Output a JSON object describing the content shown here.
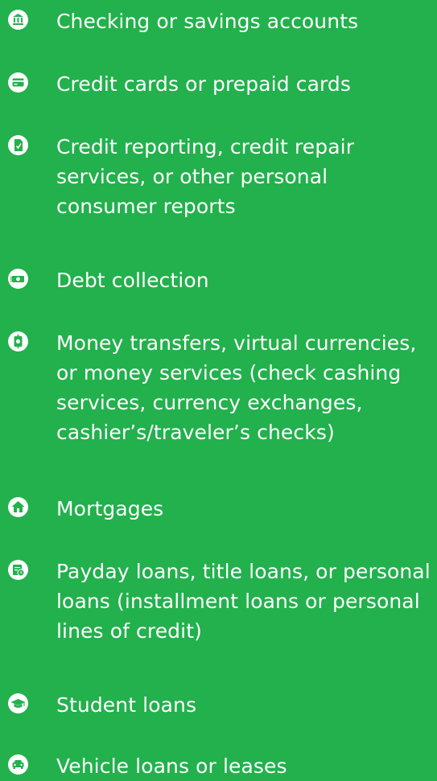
{
  "topics": {
    "items": [
      {
        "icon": "bank-icon",
        "label": "Checking or savings accounts"
      },
      {
        "icon": "credit-card-icon",
        "label": "Credit cards or prepaid cards"
      },
      {
        "icon": "credit-report-icon",
        "label": "Credit reporting, credit repair services, or other personal consumer reports"
      },
      {
        "icon": "money-icon",
        "label": "Debt collection"
      },
      {
        "icon": "money-transfer-icon",
        "label": "Money transfers, virtual currencies, or money services (check cashing services, currency exchanges, cashier’s/traveler’s checks)"
      },
      {
        "icon": "house-icon",
        "label": "Mortgages"
      },
      {
        "icon": "payday-loan-icon",
        "label": "Payday loans, title loans, or personal loans (installment loans or personal lines of credit)"
      },
      {
        "icon": "graduation-cap-icon",
        "label": "Student loans"
      },
      {
        "icon": "car-icon",
        "label": "Vehicle loans or leases"
      }
    ]
  },
  "colors": {
    "background": "#22b14c",
    "foreground": "#ffffff"
  }
}
